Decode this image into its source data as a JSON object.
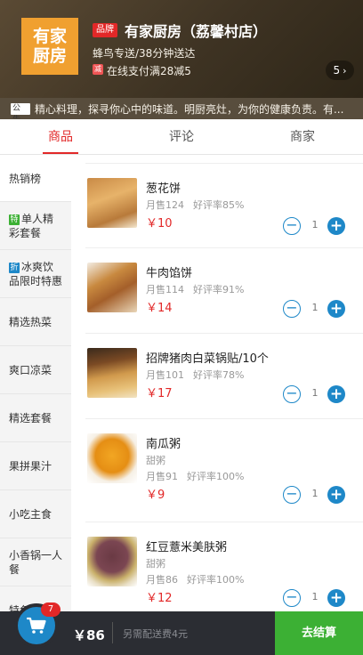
{
  "header": {
    "logo_text": "有家厨房",
    "brand_badge": "品牌",
    "store_name": "有家厨房（荔馨村店）",
    "delivery_info": "蜂鸟专送/38分钟送达",
    "promo_icon": "减",
    "promo_text": "在线支付满28减5",
    "promo_count": "5",
    "notice_tag": "公告",
    "notice_text": "精心料理，探寻你心中的味道。明厨亮灶，为你的健康负责。有..."
  },
  "tabs": [
    {
      "label": "商品",
      "active": true
    },
    {
      "label": "评论",
      "active": false
    },
    {
      "label": "商家",
      "active": false
    }
  ],
  "sidebar": {
    "items": [
      {
        "label": "热销榜",
        "tag": ""
      },
      {
        "label": "单人精彩套餐",
        "tag": "特"
      },
      {
        "label": "冰爽饮品限时特惠",
        "tag": "折"
      },
      {
        "label": "精选热菜",
        "tag": ""
      },
      {
        "label": "爽口凉菜",
        "tag": ""
      },
      {
        "label": "精选套餐",
        "tag": ""
      },
      {
        "label": "果拼果汁",
        "tag": ""
      },
      {
        "label": "小吃主食",
        "tag": ""
      },
      {
        "label": "小香锅一人餐",
        "tag": ""
      },
      {
        "label": "特色粥品",
        "tag": ""
      }
    ],
    "tag_colors": {
      "特": "#3cb034",
      "折": "#1e88c8"
    }
  },
  "products": [
    {
      "name": "葱花饼",
      "desc": "",
      "sales": "月售124",
      "rating": "好评率85%",
      "price": "￥10",
      "qty": "1"
    },
    {
      "name": "牛肉馅饼",
      "desc": "",
      "sales": "月售114",
      "rating": "好评率91%",
      "price": "￥14",
      "qty": "1"
    },
    {
      "name": "招牌猪肉白菜锅贴/10个",
      "desc": "",
      "sales": "月售101",
      "rating": "好评率78%",
      "price": "￥17",
      "qty": "1"
    },
    {
      "name": "南瓜粥",
      "desc": "甜粥",
      "sales": "月售91",
      "rating": "好评率100%",
      "price": "￥9",
      "qty": "1"
    },
    {
      "name": "红豆薏米美肤粥",
      "desc": "甜粥",
      "sales": "月售86",
      "rating": "好评率100%",
      "price": "￥12",
      "qty": "1"
    }
  ],
  "cart": {
    "badge": "7",
    "total": "￥86",
    "extra": "另需配送费4元",
    "checkout": "去结算"
  },
  "colors": {
    "accent_red": "#e22828",
    "accent_blue": "#1e88c8",
    "checkout_green": "#3cb034"
  }
}
